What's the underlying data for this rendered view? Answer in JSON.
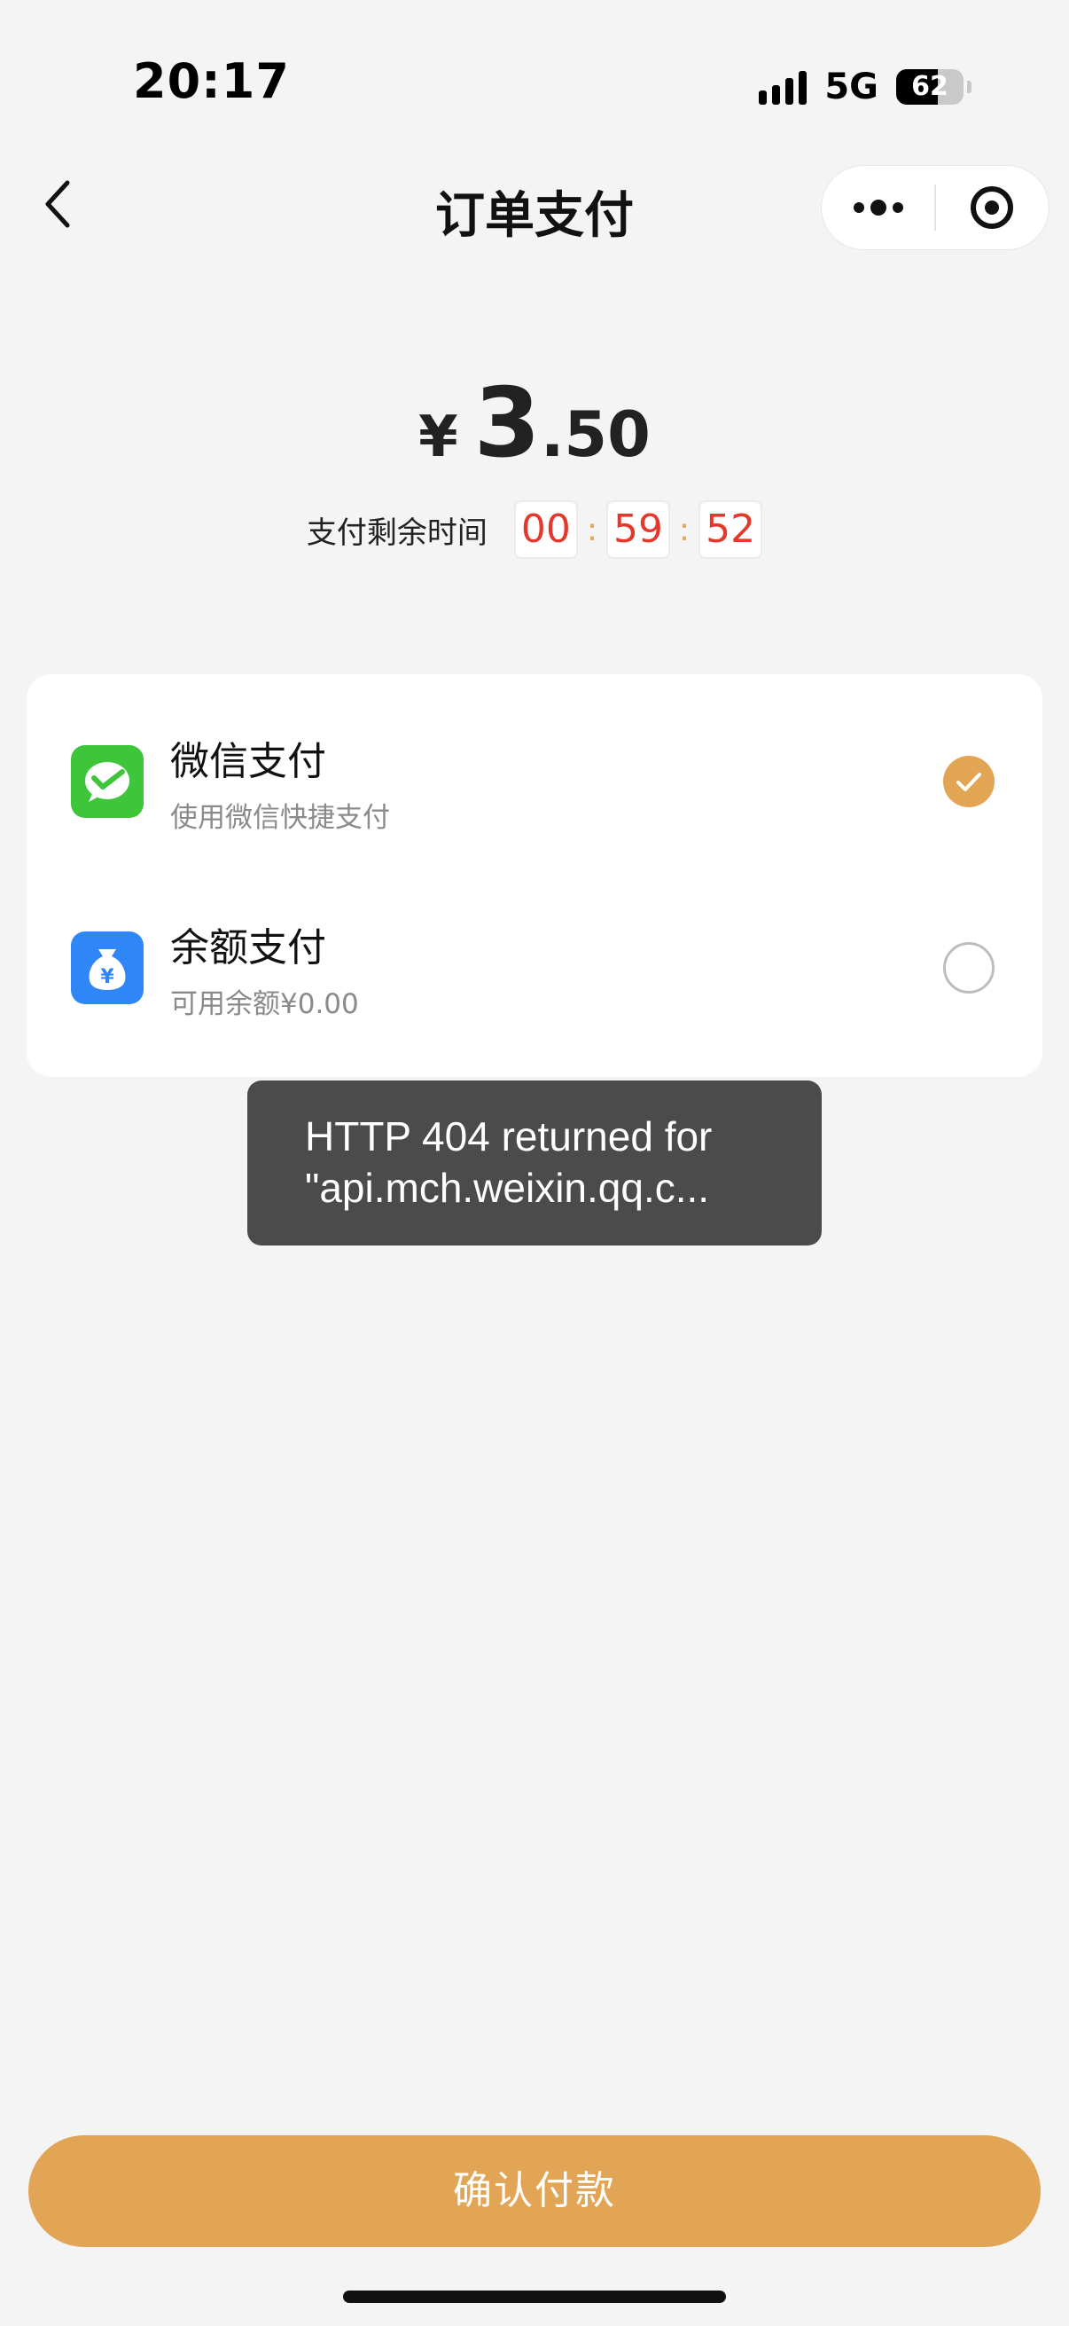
{
  "status_bar": {
    "time": "20:17",
    "network": "5G",
    "battery": "62"
  },
  "nav": {
    "title": "订单支付",
    "back_icon": "chevron-left-icon",
    "more_icon": "more-dots-icon",
    "close_icon": "target-circle-icon"
  },
  "amount": {
    "currency": "¥",
    "integer": "3",
    "decimal": ".50"
  },
  "countdown": {
    "label": "支付剩余时间",
    "hours": "00",
    "minutes": "59",
    "seconds": "52",
    "separator": ":"
  },
  "payment_methods": [
    {
      "title": "微信支付",
      "subtitle": "使用微信快捷支付",
      "icon": "wechat-pay-icon",
      "selected": true
    },
    {
      "title": "余额支付",
      "subtitle": "可用余额¥0.00",
      "icon": "balance-bag-icon",
      "selected": false
    }
  ],
  "toast": {
    "message": "HTTP 404 returned for\n\"api.mch.weixin.qq.c..."
  },
  "confirm_button": {
    "label": "确认付款"
  },
  "colors": {
    "accent": "#e2a556",
    "countdown_digits": "#e3392c",
    "wechat_green": "#3fc53a",
    "balance_blue": "#2f86f6",
    "toast_bg": "#4b4b4b"
  }
}
